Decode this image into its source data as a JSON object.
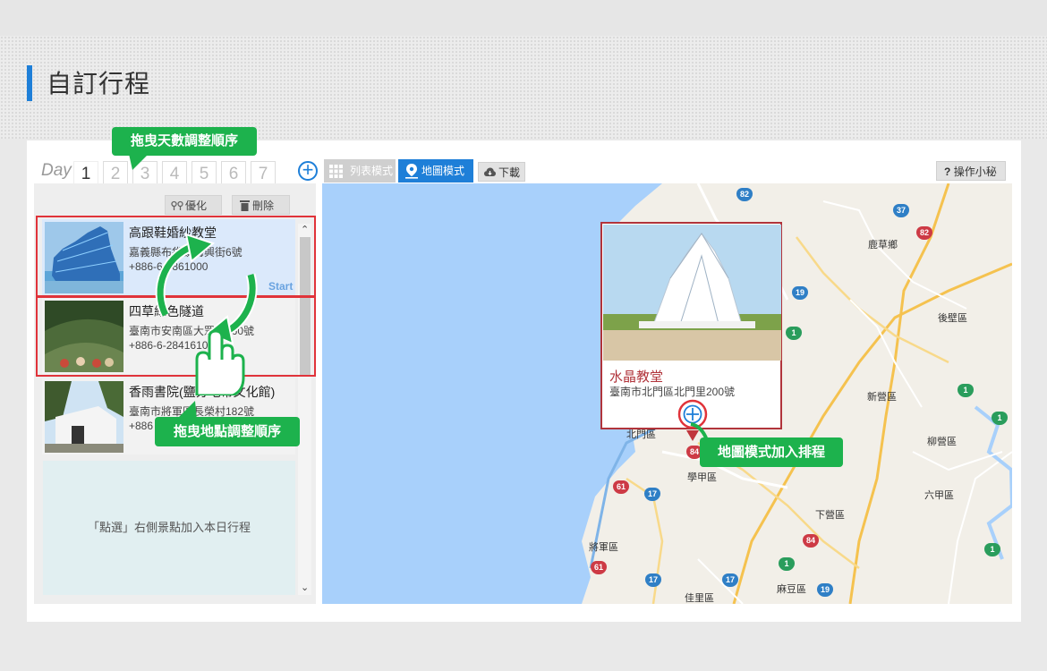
{
  "page": {
    "title": "自訂行程"
  },
  "days": {
    "label": "Day",
    "tabs": [
      "1",
      "2",
      "3",
      "4",
      "5",
      "6",
      "7"
    ],
    "active": "1",
    "add_icon": "plus-circle-icon"
  },
  "toolbar": {
    "optimize_label": "優化",
    "delete_label": "刪除"
  },
  "modes": {
    "list_label": "列表模式",
    "map_label": "地圖模式",
    "download_label": "下載",
    "help_label": "操作小秘訣"
  },
  "itinerary": {
    "items": [
      {
        "name": "高跟鞋婚紗教堂",
        "address": "嘉義縣布袋鎮海興街6號",
        "phone": "+886-6-7861000"
      },
      {
        "name": "四草綠色隧道",
        "address": "臺南市安南區大眾路360號",
        "phone": "+886-6-2841610"
      },
      {
        "name": "香雨書院(鹽分地帶文化館)",
        "address": "臺南市將軍區長榮村182號",
        "phone": "+886"
      }
    ],
    "start_label": "Start",
    "empty_hint": "「點選」右側景點加入本日行程"
  },
  "callouts": {
    "drag_days": "拖曳天數調整順序",
    "drag_places": "拖曳地點調整順序",
    "map_add": "地圖模式加入排程"
  },
  "map": {
    "popup": {
      "name": "水晶教堂",
      "address": "臺南市北門區北門里200號"
    },
    "labels": [
      "鹿草鄉",
      "後壁區",
      "新營區",
      "柳營區",
      "六甲區",
      "學甲區",
      "下營區",
      "將軍區",
      "佳里區",
      "麻豆區",
      "北門區"
    ],
    "routes": [
      "82",
      "37",
      "82",
      "19",
      "1",
      "19",
      "61",
      "84",
      "17",
      "61",
      "17",
      "84",
      "17",
      "1",
      "19",
      "1",
      "1",
      "1"
    ]
  },
  "colors": {
    "accent": "#1e7fd8",
    "callout": "#1db24d",
    "highlight": "#e0333a",
    "popup": "#b1343b"
  }
}
